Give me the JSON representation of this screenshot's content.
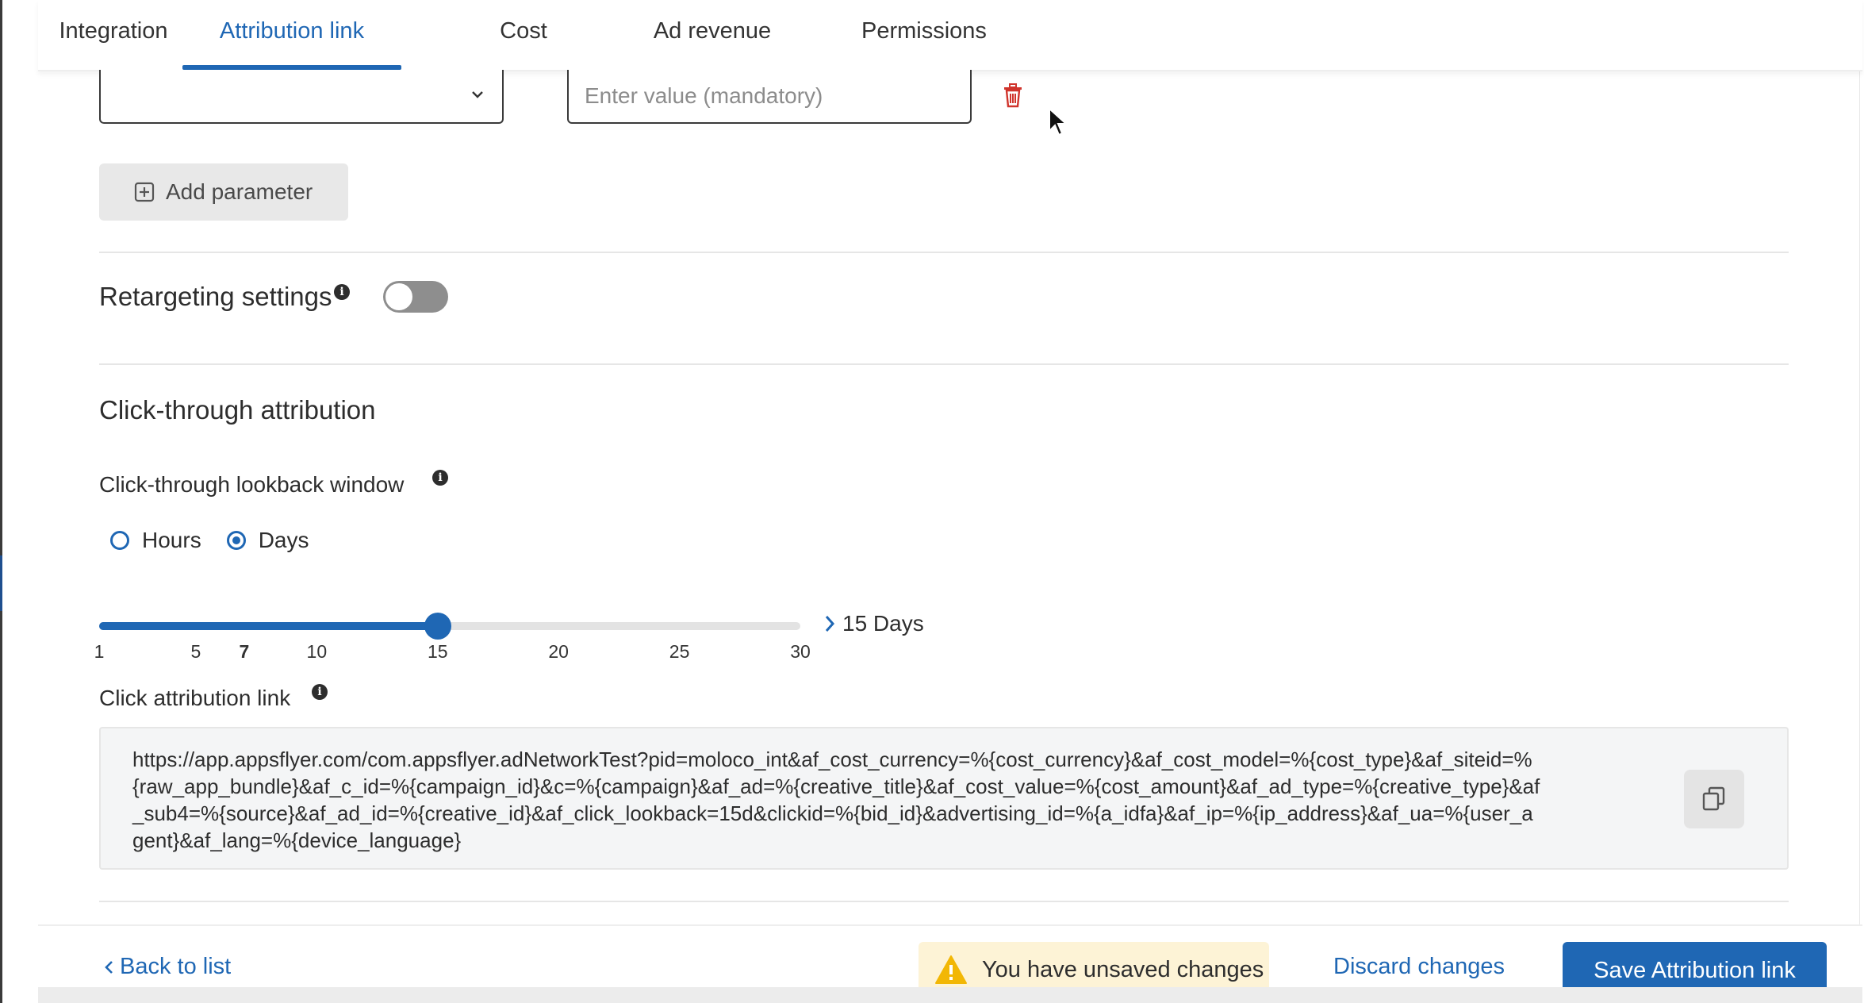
{
  "tabs": [
    {
      "label": "Integration",
      "active": false
    },
    {
      "label": "Attribution link",
      "active": true
    },
    {
      "label": "Cost",
      "active": false
    },
    {
      "label": "Ad revenue",
      "active": false
    },
    {
      "label": "Permissions",
      "active": false
    }
  ],
  "parameter_row": {
    "select_value": "",
    "value_placeholder": "Enter value (mandatory)",
    "value": ""
  },
  "add_parameter_label": "Add parameter",
  "retargeting": {
    "label": "Retargeting settings",
    "enabled": false
  },
  "click_through": {
    "title": "Click-through attribution",
    "lookback_label": "Click-through lookback window",
    "units": [
      {
        "label": "Hours",
        "selected": false
      },
      {
        "label": "Days",
        "selected": true
      }
    ],
    "slider": {
      "min": 1,
      "max": 30,
      "value": 15,
      "ticks": [
        "1",
        "5",
        "7",
        "10",
        "15",
        "20",
        "25",
        "30"
      ],
      "bold_tick": "7",
      "value_text": "15 Days"
    },
    "link_label": "Click attribution link",
    "link_url": "https://app.appsflyer.com/com.appsflyer.adNetworkTest?pid=moloco_int&af_cost_currency=%{cost_currency}&af_cost_model=%{cost_type}&af_siteid=%{raw_app_bundle}&af_c_id=%{campaign_id}&c=%{campaign}&af_ad=%{creative_title}&af_cost_value=%{cost_amount}&af_ad_type=%{creative_type}&af_sub4=%{source}&af_ad_id=%{creative_id}&af_click_lookback=15d&clickid=%{bid_id}&advertising_id=%{a_idfa}&af_ip=%{ip_address}&af_ua=%{user_agent}&af_lang=%{device_language}"
  },
  "footer": {
    "back_label": "Back to list",
    "unsaved_text": "You have unsaved changes",
    "discard_label": "Discard changes",
    "save_label": "Save Attribution link"
  },
  "colors": {
    "accent": "#1f67b4",
    "warning_bg": "#fdf3d6",
    "warning_icon": "#f2b705",
    "delete": "#d0342c"
  },
  "icons": [
    "chevron-down-icon",
    "trash-icon",
    "plus-square-icon",
    "info-icon",
    "chevron-right-icon",
    "copy-icon",
    "warning-icon",
    "chevron-left-icon",
    "cursor-icon"
  ]
}
